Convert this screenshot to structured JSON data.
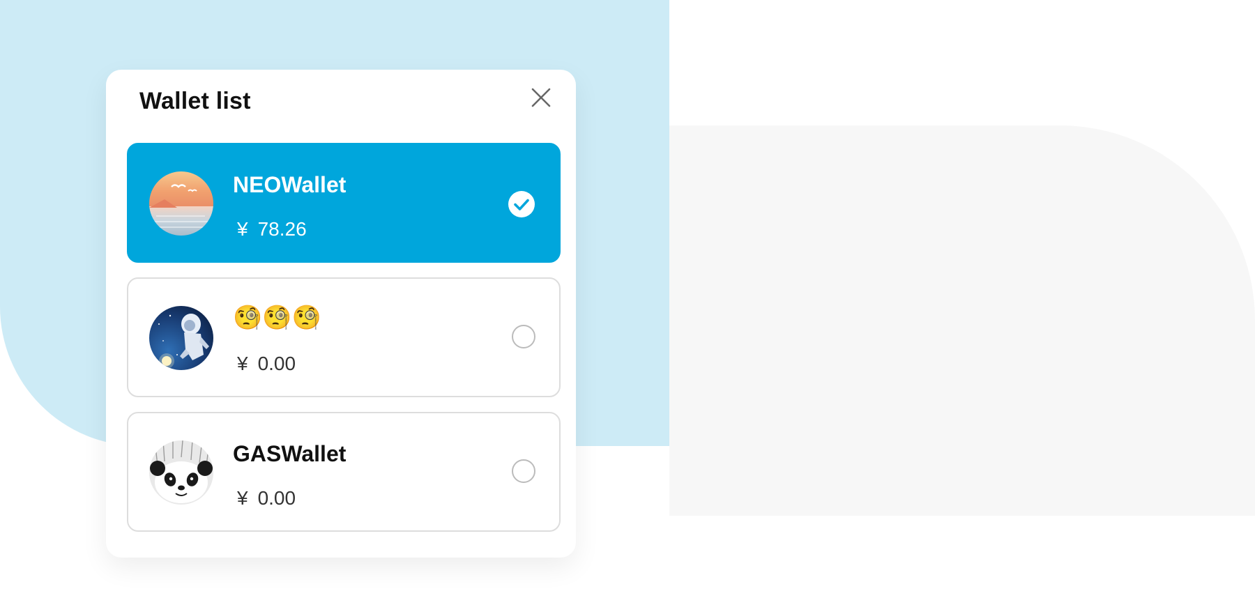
{
  "modal": {
    "title": "Wallet list",
    "close_icon": "close-icon"
  },
  "wallets": [
    {
      "name": "NEOWallet",
      "currency_symbol": "¥",
      "balance": "78.26",
      "avatar_icon": "sunset-sea-avatar",
      "selected": true
    },
    {
      "name": "🧐🧐🧐",
      "currency_symbol": "¥",
      "balance": "0.00",
      "avatar_icon": "astronaut-avatar",
      "selected": false
    },
    {
      "name": "GASWallet",
      "currency_symbol": "¥",
      "balance": "0.00",
      "avatar_icon": "panda-avatar",
      "selected": false
    }
  ],
  "colors": {
    "accent": "#00a6dc",
    "background_blue": "#cdebf6",
    "background_gray": "#f7f7f7",
    "card_border": "#dddddd"
  }
}
